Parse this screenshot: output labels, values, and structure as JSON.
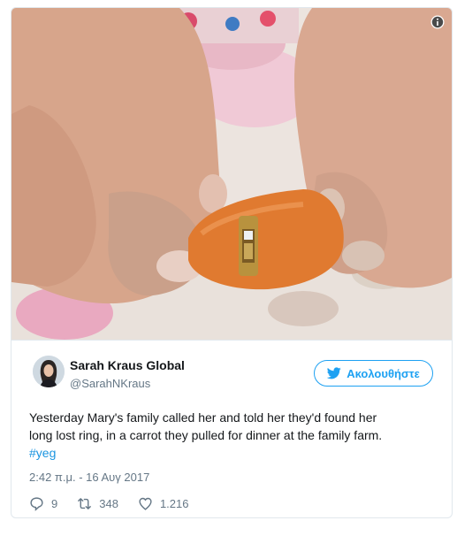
{
  "author": {
    "name": "Sarah Kraus Global",
    "handle": "@SarahNKraus"
  },
  "follow_button": {
    "label": "Ακολουθήστε"
  },
  "tweet": {
    "line1": "Yesterday Mary's family called her and told her they'd found her",
    "line2": "long lost ring, in a carrot they pulled for dinner at the family farm.",
    "hashtag": "#yeg"
  },
  "timestamp": "2:42 π.μ. - 16 Αυγ 2017",
  "actions": {
    "replies": "9",
    "retweets": "348",
    "likes": "1.216"
  },
  "colors": {
    "accent": "#1da1f2",
    "link": "#1b95e0",
    "muted": "#657786",
    "border": "#e1e8ed"
  },
  "icons": {
    "info": "info-icon",
    "follow": "twitter-bird-icon",
    "reply": "reply-icon",
    "retweet": "retweet-icon",
    "like": "heart-icon"
  }
}
